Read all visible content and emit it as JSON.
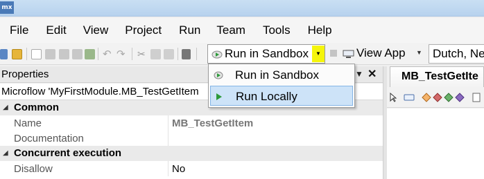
{
  "app": {
    "logo_text": "mx"
  },
  "menu": {
    "items": [
      "File",
      "Edit",
      "View",
      "Project",
      "Run",
      "Team",
      "Tools",
      "Help"
    ]
  },
  "toolbar": {
    "run_dropdown_label": "Run in Sandbox",
    "view_app_label": "View App",
    "language_label": "Dutch, Ne",
    "highlight_color": "#f5f50a"
  },
  "run_menu": {
    "items": [
      {
        "label": "Run in Sandbox",
        "icon": "cloud-run-icon",
        "selected": false
      },
      {
        "label": "Run Locally",
        "icon": "play-icon",
        "selected": true
      }
    ]
  },
  "properties": {
    "title": "Properties",
    "subject": "Microflow 'MyFirstModule.MB_TestGetItem",
    "categories": [
      {
        "label": "Common",
        "rows": [
          {
            "name": "Name",
            "value": "MB_TestGetItem",
            "style": "gray"
          },
          {
            "name": "Documentation",
            "value": ""
          }
        ]
      },
      {
        "label": "Concurrent execution",
        "rows": [
          {
            "name": "Disallow",
            "value": "No"
          }
        ]
      }
    ]
  },
  "editor": {
    "tab_label": "MB_TestGetIte"
  }
}
